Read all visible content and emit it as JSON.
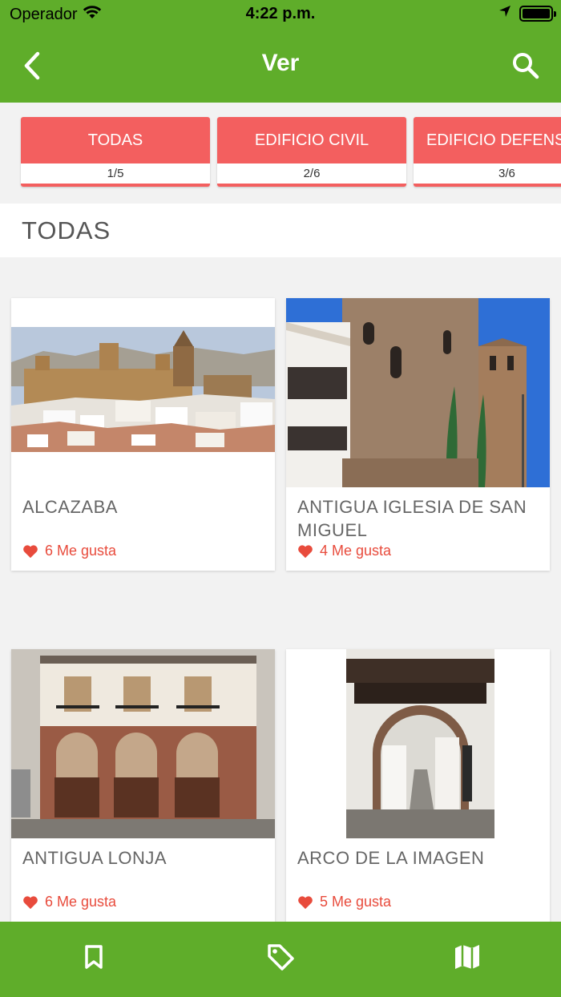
{
  "status": {
    "carrier": "Operador",
    "time": "4:22 p.m."
  },
  "navbar": {
    "title": "Ver",
    "back_icon": "chevron-left-icon",
    "search_icon": "search-icon"
  },
  "tabs": [
    {
      "label": "TODAS",
      "count": "1/5"
    },
    {
      "label": "EDIFICIO CIVIL",
      "count": "2/6"
    },
    {
      "label": "EDIFICIO DEFENSIVO",
      "count": "3/6"
    }
  ],
  "section": {
    "title": "TODAS"
  },
  "cards": [
    {
      "title": "ALCAZABA",
      "likes": "6 Me gusta"
    },
    {
      "title": "ANTIGUA IGLESIA DE SAN MIGUEL",
      "likes": "4 Me gusta"
    },
    {
      "title": "ANTIGUA LONJA",
      "likes": "6 Me gusta"
    },
    {
      "title": "ARCO DE LA IMAGEN",
      "likes": "5 Me gusta"
    }
  ],
  "bottom_nav": {
    "items": [
      "bookmark-icon",
      "tag-icon",
      "map-icon"
    ]
  },
  "colors": {
    "brand_green": "#5fad2a",
    "tab_red": "#f35f5f",
    "heart_red": "#e84b3c"
  }
}
